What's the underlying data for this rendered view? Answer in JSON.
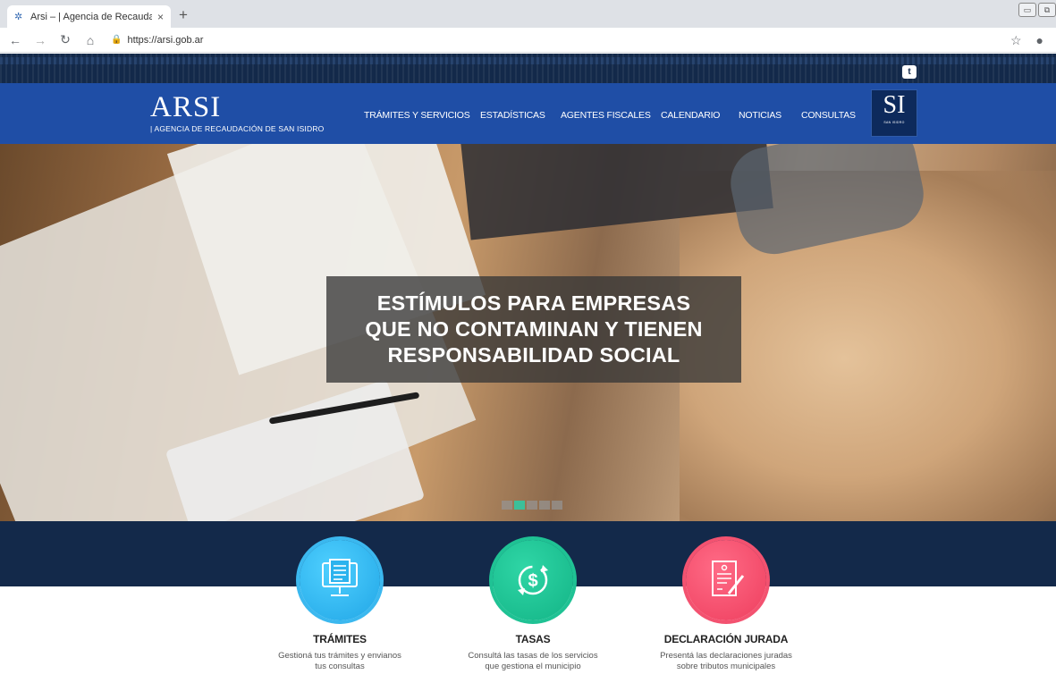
{
  "browser": {
    "tab_title": "Arsi – | Agencia de Recaudació",
    "tab_close": "×",
    "new_tab": "+",
    "url": "https://arsi.gob.ar",
    "icons": [
      "back-icon",
      "forward-icon",
      "reload-icon",
      "home-icon",
      "lock-icon",
      "star-icon",
      "profile-icon"
    ]
  },
  "site": {
    "logo_title": "ARSI",
    "logo_subtitle": "| AGENCIA DE RECAUDACIÓN DE SAN ISIDRO",
    "menu": [
      {
        "label": "TRÁMITES Y SERVICIOS"
      },
      {
        "label": "ESTADÍSTICAS"
      },
      {
        "label": "AGENTES FISCALES"
      },
      {
        "label": "CALENDARIO"
      },
      {
        "label": "NOTICIAS"
      },
      {
        "label": "CONSULTAS"
      }
    ],
    "si_logo": "SI",
    "si_logo_small": "SAN ISIDRO",
    "twitter_icon": "twitter-icon"
  },
  "hero": {
    "lines": [
      "ESTÍMULOS PARA EMPRESAS",
      "QUE NO CONTAMINAN Y TIENEN",
      "RESPONSABILIDAD SOCIAL"
    ],
    "slide_count": 5,
    "active_slide": 2
  },
  "services": [
    {
      "title": "TRÁMITES",
      "desc_line1": "Gestioná tus trámites y envianos",
      "desc_line2": "tus consultas",
      "color": "#21a6e6",
      "icon": "monitor-document-icon"
    },
    {
      "title": "TASAS",
      "desc_line1": "Consultá las tasas de los servicios",
      "desc_line2": "que gestiona el municipio",
      "color": "#13b486",
      "icon": "dollar-cycle-icon"
    },
    {
      "title": "DECLARACIÓN JURADA",
      "desc_line1": "Presentá las declaraciones juradas",
      "desc_line2": "sobre tributos municipales",
      "color": "#ee3e5e",
      "icon": "signed-document-icon"
    }
  ]
}
